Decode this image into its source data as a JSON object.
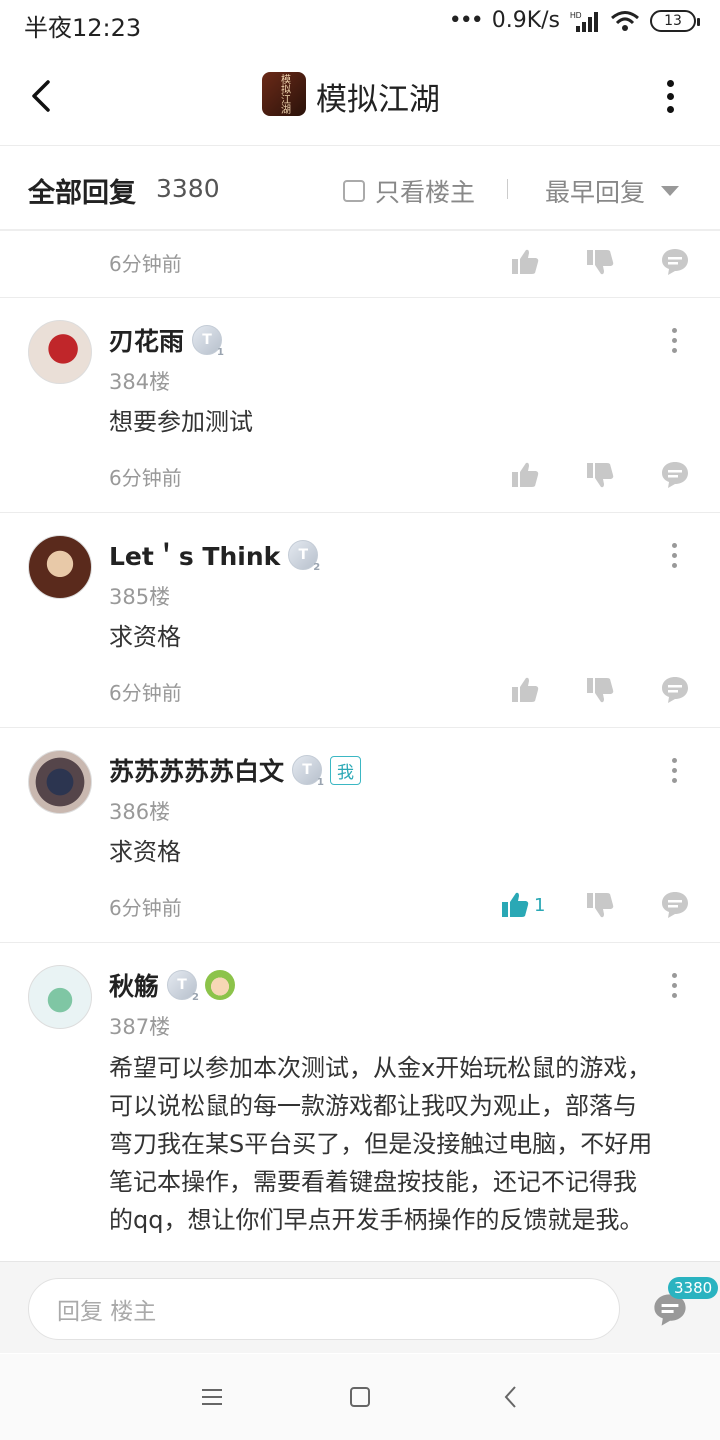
{
  "status_bar": {
    "time": "半夜12:23",
    "network_speed": "0.9K/s",
    "battery": "13"
  },
  "header": {
    "app_icon_text": "模拟江湖",
    "title": "模拟江湖"
  },
  "filter_bar": {
    "all_replies_label": "全部回复",
    "count": "3380",
    "owner_only_label": "只看楼主",
    "sort_label": "最早回复"
  },
  "posts": [
    {
      "time": "6分钟前"
    },
    {
      "username": "刃花雨",
      "badge_level": "1",
      "floor": "384楼",
      "content": "想要参加测试",
      "time": "6分钟前"
    },
    {
      "username": "Let＇s Think",
      "badge_level": "2",
      "floor": "385楼",
      "content": "求资格",
      "time": "6分钟前"
    },
    {
      "username": "苏苏苏苏苏白文",
      "badge_level": "1",
      "me_tag": "我",
      "floor": "386楼",
      "content": "求资格",
      "time": "6分钟前",
      "likes": "1"
    },
    {
      "username": "秋觞",
      "badge_level": "2",
      "floor": "387楼",
      "content_lines": [
        "希望可以参加本次测试，从金x开始玩松鼠的游戏，",
        "可以说松鼠的每一款游戏都让我叹为观止，部落与",
        "弯刀我在某S平台买了，但是没接触过电脑，不好用",
        "笔记本操作，需要看着键盘按技能，还记不记得我",
        "的qq，想让你们早点开发手柄操作的反馈就是我。"
      ]
    }
  ],
  "reply_bar": {
    "placeholder": "回复  楼主",
    "badge": "3380"
  },
  "icons": {
    "like": "thumbs-up-icon",
    "dislike": "thumbs-down-icon",
    "comment": "comment-icon"
  },
  "colors": {
    "accent": "#2aa8b5",
    "muted": "#999999"
  }
}
